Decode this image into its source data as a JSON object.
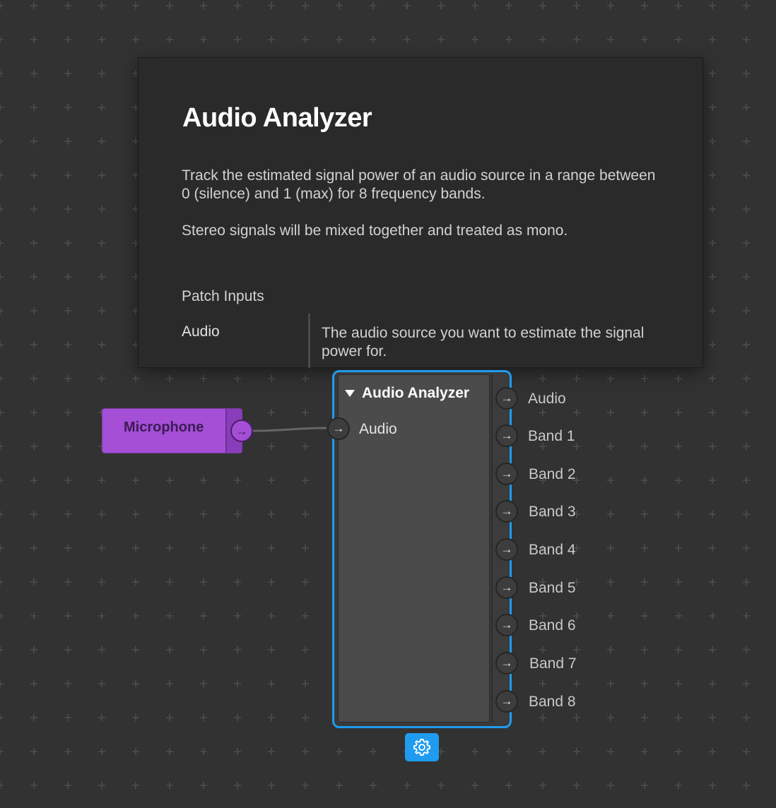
{
  "colors": {
    "canvas_bg": "#323232",
    "grid_plus": "#4e4e4e",
    "accent_blue": "#1f9cf0",
    "microphone_purple": "#a44fd6",
    "cable": "#666666"
  },
  "tooltip": {
    "title": "Audio Analyzer",
    "description_1": "Track the estimated signal power of an audio source in a range between 0 (silence) and 1 (max) for 8 frequency bands.",
    "description_2": "Stereo signals will be mixed together and treated as mono.",
    "section_title": "Patch Inputs",
    "inputs": [
      {
        "name": "Audio",
        "description": "The audio source you want to estimate the signal power for."
      }
    ]
  },
  "microphone_node": {
    "label": "Microphone",
    "output_icon": "arrow-right-icon"
  },
  "analyzer_node": {
    "title": "Audio Analyzer",
    "collapse_icon": "triangle-down-icon",
    "inputs": [
      {
        "label": "Audio",
        "icon": "arrow-right-icon"
      }
    ],
    "outputs": [
      {
        "label": "Audio"
      },
      {
        "label": "Band 1"
      },
      {
        "label": "Band 2"
      },
      {
        "label": "Band 3"
      },
      {
        "label": "Band 4"
      },
      {
        "label": "Band 5"
      },
      {
        "label": "Band 6"
      },
      {
        "label": "Band 7"
      },
      {
        "label": "Band 8"
      }
    ],
    "settings_icon": "gear-icon"
  }
}
